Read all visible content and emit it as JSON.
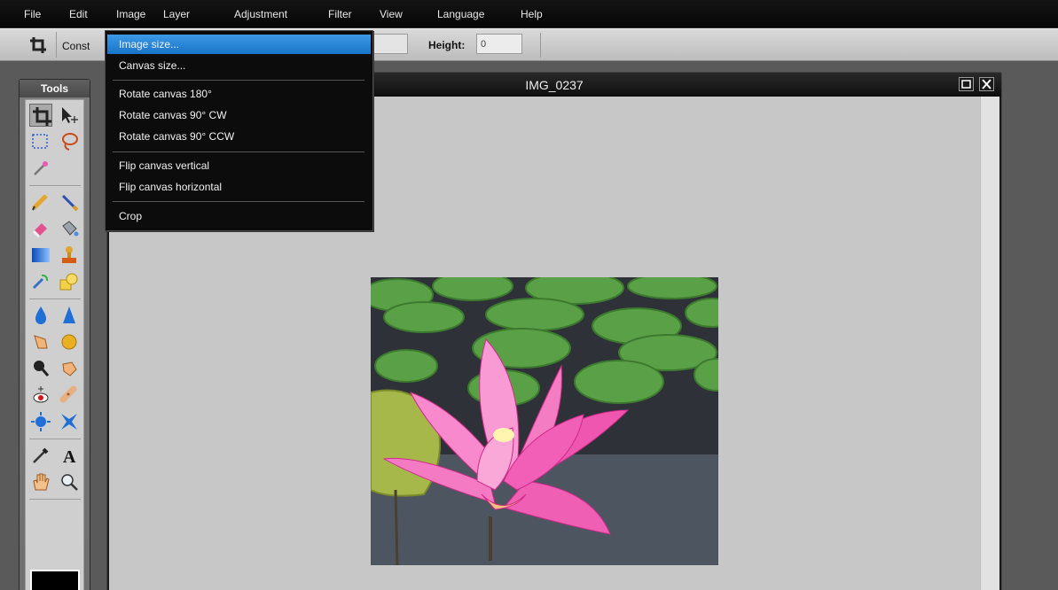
{
  "menubar": {
    "items": [
      {
        "label": "File"
      },
      {
        "label": "Edit"
      },
      {
        "label": "Image"
      },
      {
        "label": "Layer"
      },
      {
        "label": "Adjustment"
      },
      {
        "label": "Filter"
      },
      {
        "label": "View"
      },
      {
        "label": "Language"
      },
      {
        "label": "Help"
      }
    ]
  },
  "options_bar": {
    "tool_icon": "crop-icon",
    "constrain_label": "Const",
    "height_label": "Height:",
    "height_value": "0"
  },
  "tools_panel": {
    "title": "Tools",
    "tools": [
      "crop-icon",
      "move-icon",
      "marquee-icon",
      "lasso-icon",
      "magic-wand-icon",
      "pencil-icon",
      "brush-icon",
      "eraser-icon",
      "paint-bucket-icon",
      "gradient-icon",
      "clone-stamp-icon",
      "color-replace-icon",
      "shape-icon",
      "blur-icon",
      "sharpen-icon",
      "smudge-icon",
      "sponge-icon",
      "burn-icon",
      "dodge-icon",
      "red-eye-icon",
      "spot-heal-icon",
      "bloat-icon",
      "pinch-icon",
      "color-picker-icon",
      "text-icon",
      "hand-icon",
      "zoom-icon"
    ],
    "foreground_color": "#000000"
  },
  "document": {
    "title": "IMG_0237",
    "maximize_icon": "maximize-icon",
    "close_icon": "close-icon"
  },
  "image_menu": {
    "items": [
      {
        "label": "Image size...",
        "highlighted": true
      },
      {
        "label": "Canvas size..."
      },
      {
        "label": "Rotate canvas 180°"
      },
      {
        "label": "Rotate canvas 90° CW"
      },
      {
        "label": "Rotate canvas 90° CCW"
      },
      {
        "label": "Flip canvas vertical"
      },
      {
        "label": "Flip canvas horizontal"
      },
      {
        "label": "Crop"
      }
    ]
  },
  "colors": {
    "menu_highlight": "#2e88d8",
    "canvas_bg": "#c7c7c7",
    "app_bg": "#5a5a5a"
  }
}
